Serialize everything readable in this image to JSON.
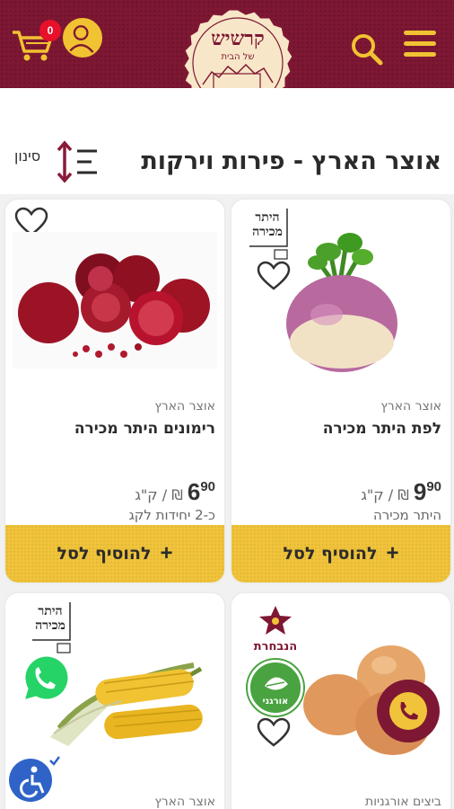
{
  "header": {
    "cart_count": "0",
    "logo_title": "קרשיש",
    "logo_subtitle": "של הבית"
  },
  "category": {
    "title": "אוצר הארץ - פירות וירקות",
    "filter_label": "סינון"
  },
  "products": [
    {
      "badge": "היתר מכירה",
      "category": "אוצר הארץ",
      "name": "לפת היתר מכירה",
      "price_main": "9",
      "price_dec": "90",
      "price_unit": "₪ / ק\"ג",
      "sub": "היתר מכירה",
      "add_label": "להוסיף לסל"
    },
    {
      "category": "אוצר הארץ",
      "name": "רימונים היתר מכירה",
      "price_main": "6",
      "price_dec": "90",
      "price_unit": "₪ / ק\"ג",
      "sub": "כ-2 יחידות לקג",
      "add_label": "להוסיף לסל"
    },
    {
      "badge": "הנבחרת",
      "category": "ביצים אורגניות",
      "organic_label": "אורגני"
    },
    {
      "badge": "היתר מכירה",
      "category": "אוצר הארץ"
    }
  ],
  "colors": {
    "brand": "#7e1733",
    "accent": "#f0c33a",
    "badge": "#e8102a"
  }
}
